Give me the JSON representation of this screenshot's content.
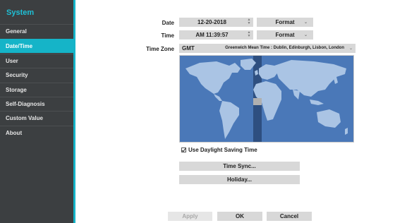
{
  "sidebar": {
    "title": "System",
    "items": [
      {
        "label": "General"
      },
      {
        "label": "Date/Time"
      },
      {
        "label": "User"
      },
      {
        "label": "Security"
      },
      {
        "label": "Storage"
      },
      {
        "label": "Self-Diagnosis"
      },
      {
        "label": "Custom Value"
      },
      {
        "label": "About"
      }
    ],
    "active_index": 1
  },
  "form": {
    "date_label": "Date",
    "date_value": "12-20-2018",
    "date_format_label": "Format",
    "time_label": "Time",
    "time_value": "AM 11:39:57",
    "time_format_label": "Format",
    "timezone_label": "Time Zone",
    "timezone_code": "GMT",
    "timezone_name": "Greenwich Mean Time : Dublin, Edinburgh, Lisbon, London",
    "dst_label": "Use Daylight Saving Time",
    "dst_checked": true,
    "time_sync_label": "Time Sync...",
    "holiday_label": "Holiday..."
  },
  "footer": {
    "apply_label": "Apply",
    "ok_label": "OK",
    "cancel_label": "Cancel"
  },
  "colors": {
    "accent": "#15b4c8",
    "sidebar_bg": "#3c3f41",
    "map_ocean": "#4a78b8",
    "map_land": "#aac4e4",
    "map_selected_band": "#2e4f80"
  }
}
